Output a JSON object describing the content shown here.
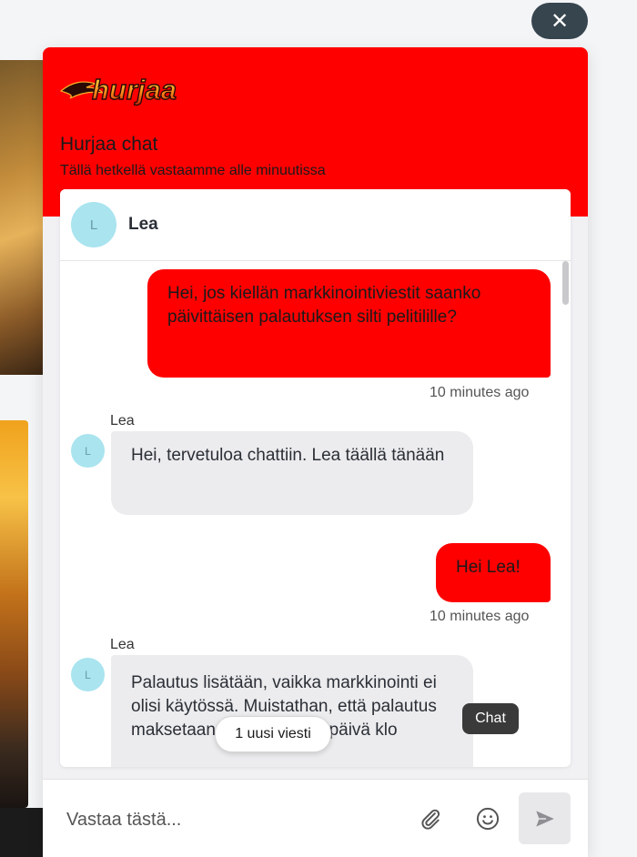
{
  "widget": {
    "brand_logo_text": "hurjaa",
    "title": "Hurjaa chat",
    "subtitle": "Tällä hetkellä vastaamme alle minuutissa",
    "accent_color": "#ff0000"
  },
  "agent": {
    "initial": "L",
    "name": "Lea"
  },
  "messages": [
    {
      "direction": "out",
      "text": "Hei, jos kiellän markkinointiviestit saanko päivittäisen palautuksen silti pelitilille?",
      "time": "10 minutes ago"
    },
    {
      "direction": "in",
      "sender": "Lea",
      "text": "Hei, tervetuloa chattiin. Lea täällä tänään"
    },
    {
      "direction": "out",
      "text": "Hei Lea!",
      "time": "10 minutes ago"
    },
    {
      "direction": "in",
      "sender": "Lea",
      "text": "Palautus lisätään, vaikka markkinointi ei olisi käytössä. Muistathan, että palautus maksetaan pelaajille joka päivä klo"
    }
  ],
  "new_messages_label": "1 uusi viesti",
  "tooltip_label": "Chat",
  "composer": {
    "placeholder": "Vastaa tästä..."
  },
  "icons": {
    "close": "close-icon",
    "attach": "paperclip-icon",
    "emoji": "smiley-icon",
    "send": "send-icon"
  }
}
